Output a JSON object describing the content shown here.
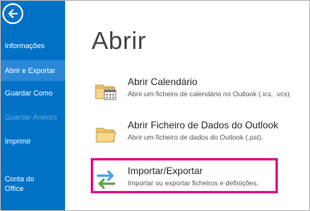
{
  "sidebar": {
    "back_icon": "back-arrow-icon",
    "items": [
      {
        "label": "Informações",
        "state": "normal"
      },
      {
        "label": "Abrir e Exportar",
        "state": "selected"
      },
      {
        "label": "Guardar Como",
        "state": "normal"
      },
      {
        "label": "Guardar Anexos",
        "state": "disabled"
      },
      {
        "label": "Imprimir",
        "state": "normal"
      },
      {
        "label": "Conta do",
        "label2": "Office",
        "state": "normal"
      }
    ]
  },
  "main": {
    "title": "Abrir",
    "options": [
      {
        "title": "Abrir Calendário",
        "description": "Abrir um ficheiro de calendário no Outlook (.ics, .vcs).",
        "icon": "folder-calendar-icon"
      },
      {
        "title": "Abrir Ficheiro de Dados do Outlook",
        "description": "Abrir um ficheiro de dados do Outlook (.pst).",
        "icon": "folder-open-icon"
      },
      {
        "title": "Importar/Exportar",
        "description": "Importar ou exportar ficheiros e definições.",
        "icon": "import-export-arrows-icon",
        "highlighted": true
      }
    ]
  },
  "colors": {
    "sidebar": "#0072c6",
    "sidebar_selected": "#2b88d8",
    "highlight_border": "#e0118c",
    "folder": "#e8c36a"
  }
}
